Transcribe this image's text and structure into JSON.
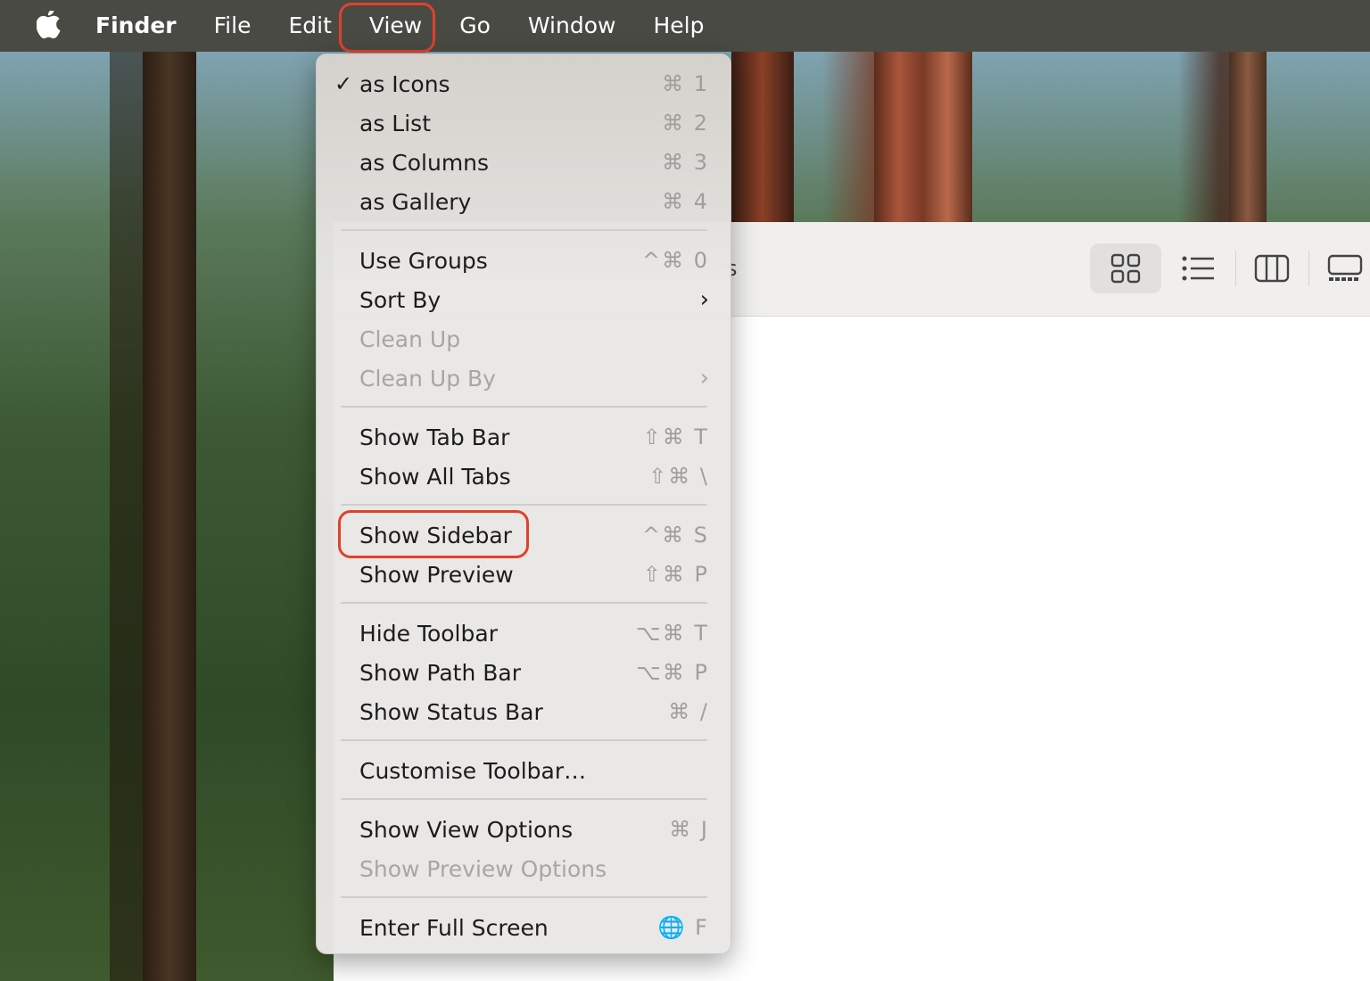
{
  "menubar": {
    "apple_icon": "apple-logo-icon",
    "items": [
      "Finder",
      "File",
      "Edit",
      "View",
      "Go",
      "Window",
      "Help"
    ],
    "active": "View"
  },
  "view_menu": {
    "groups": [
      [
        {
          "label": "as Icons",
          "shortcut": "⌘ 1",
          "checked": true
        },
        {
          "label": "as List",
          "shortcut": "⌘ 2"
        },
        {
          "label": "as Columns",
          "shortcut": "⌘ 3"
        },
        {
          "label": "as Gallery",
          "shortcut": "⌘ 4"
        }
      ],
      [
        {
          "label": "Use Groups",
          "shortcut": "^⌘ 0"
        },
        {
          "label": "Sort By",
          "submenu": true
        },
        {
          "label": "Clean Up",
          "disabled": true
        },
        {
          "label": "Clean Up By",
          "submenu": true,
          "disabled": true
        }
      ],
      [
        {
          "label": "Show Tab Bar",
          "shortcut": "⇧⌘ T"
        },
        {
          "label": "Show All Tabs",
          "shortcut": "⇧⌘ \\"
        }
      ],
      [
        {
          "label": "Show Sidebar",
          "shortcut": "^⌘ S",
          "highlighted": true
        },
        {
          "label": "Show Preview",
          "shortcut": "⇧⌘ P"
        }
      ],
      [
        {
          "label": "Hide Toolbar",
          "shortcut": "⌥⌘ T"
        },
        {
          "label": "Show Path Bar",
          "shortcut": "⌥⌘ P"
        },
        {
          "label": "Show Status Bar",
          "shortcut": "⌘ /"
        }
      ],
      [
        {
          "label": "Customise Toolbar…"
        }
      ],
      [
        {
          "label": "Show View Options",
          "shortcut": "⌘ J"
        },
        {
          "label": "Show Preview Options",
          "disabled": true
        }
      ],
      [
        {
          "label": "Enter Full Screen",
          "shortcut": "🌐 F"
        }
      ]
    ]
  },
  "finder_toolbar": {
    "view_buttons": [
      "icon-view-icon",
      "list-view-icon",
      "column-view-icon",
      "gallery-view-icon"
    ],
    "selected": "icon-view-icon"
  },
  "colors": {
    "highlight_ring": "#e0412c",
    "menubar_bg": "#4a4a44",
    "menu_bg": "#e9e7e5"
  }
}
